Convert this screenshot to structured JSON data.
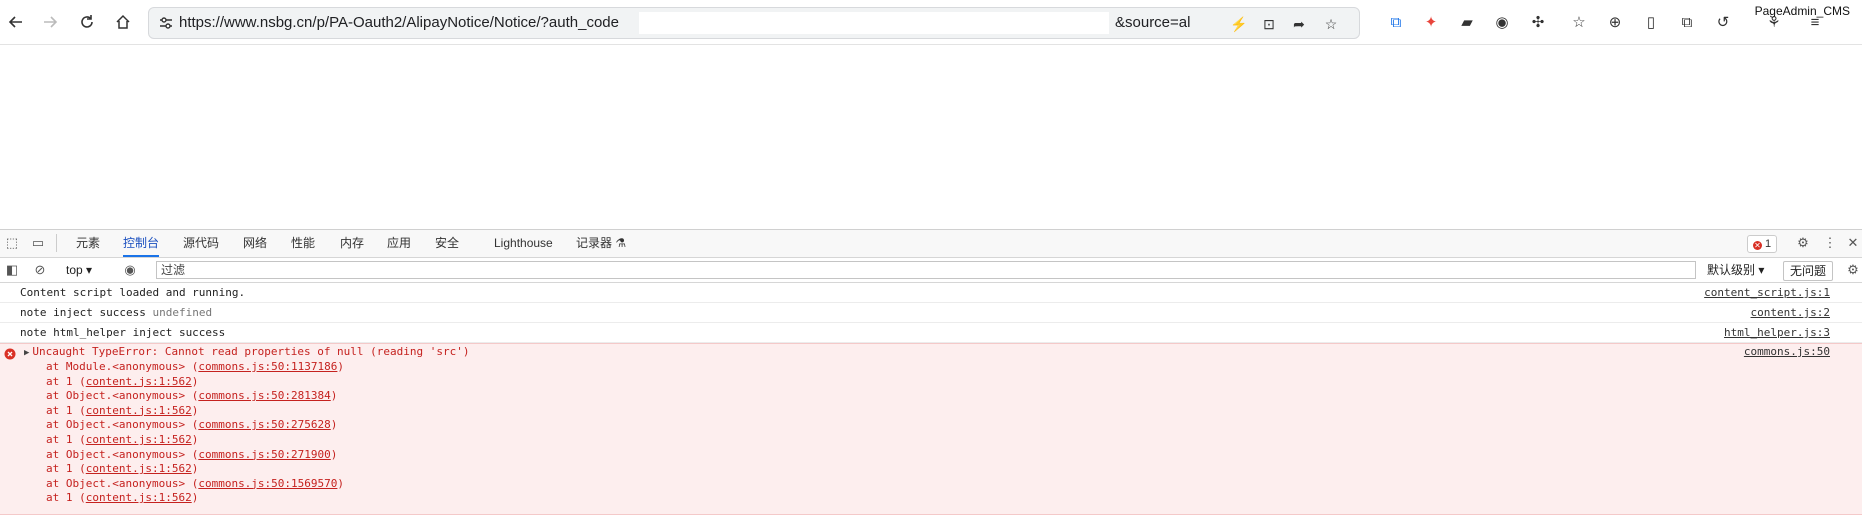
{
  "browser": {
    "url": "https://www.nsbg.cn/p/PA-Oauth2/AlipayNotice/Notice/?auth_code",
    "url_tail": "&source=al",
    "profile_label": "PageAdmin_CMS",
    "icons": {
      "back": "arrow-left-icon",
      "forward": "arrow-right-icon",
      "reload": "reload-icon",
      "home": "home-icon",
      "site_info": "tune-icon",
      "bookmark": "star-icon"
    }
  },
  "devtools": {
    "tabs": [
      {
        "label": "元素"
      },
      {
        "label": "控制台",
        "active": true
      },
      {
        "label": "源代码"
      },
      {
        "label": "网络"
      },
      {
        "label": "性能"
      },
      {
        "label": "内存"
      },
      {
        "label": "应用"
      },
      {
        "label": "安全"
      },
      {
        "label": "Lighthouse"
      },
      {
        "label": "记录器 ⚗"
      }
    ],
    "error_count": "1",
    "context": "top",
    "filter_placeholder": "过滤",
    "level_label": "默认级别",
    "issues_label": "无问题",
    "messages": [
      {
        "text": "Content script loaded and running.",
        "src": "content_script.js:1"
      },
      {
        "text": "note inject success",
        "extra": "undefined",
        "src": "content.js:2"
      },
      {
        "text": "note html_helper inject success",
        "src": "html_helper.js:3"
      }
    ],
    "error": {
      "message": "Uncaught TypeError: Cannot read properties of null (reading 'src')",
      "src": "commons.js:50",
      "stack": [
        {
          "prefix": "at Module.<anonymous> (",
          "link": "commons.js:50:1137186",
          "suffix": ")"
        },
        {
          "prefix": "at 1 (",
          "link": "content.js:1:562",
          "suffix": ")"
        },
        {
          "prefix": "at Object.<anonymous> (",
          "link": "commons.js:50:281384",
          "suffix": ")"
        },
        {
          "prefix": "at 1 (",
          "link": "content.js:1:562",
          "suffix": ")"
        },
        {
          "prefix": "at Object.<anonymous> (",
          "link": "commons.js:50:275628",
          "suffix": ")"
        },
        {
          "prefix": "at 1 (",
          "link": "content.js:1:562",
          "suffix": ")"
        },
        {
          "prefix": "at Object.<anonymous> (",
          "link": "commons.js:50:271900",
          "suffix": ")"
        },
        {
          "prefix": "at 1 (",
          "link": "content.js:1:562",
          "suffix": ")"
        },
        {
          "prefix": "at Object.<anonymous> (",
          "link": "commons.js:50:1569570",
          "suffix": ")"
        },
        {
          "prefix": "at 1 (",
          "link": "content.js:1:562",
          "suffix": ")"
        }
      ]
    },
    "colors": {
      "accent": "#1a73e8",
      "error_text": "#c5221f",
      "error_bg": "#fdeeee"
    }
  }
}
